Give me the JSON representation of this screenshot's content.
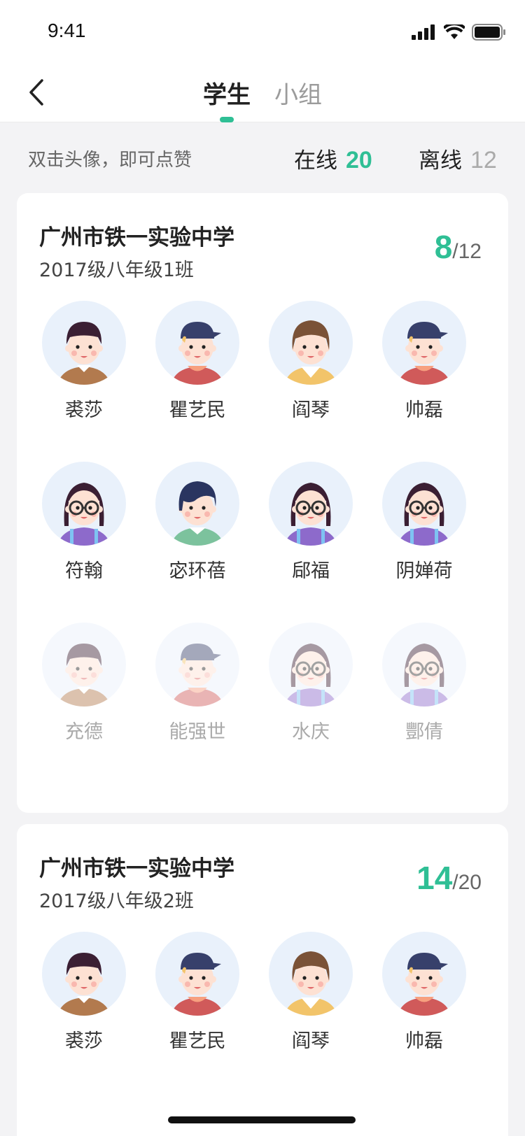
{
  "status": {
    "time": "9:41"
  },
  "header": {
    "tabs": [
      {
        "label": "学生",
        "active": true
      },
      {
        "label": "小组",
        "active": false
      }
    ]
  },
  "summary": {
    "hint": "双击头像，即可点赞",
    "online_label": "在线",
    "online_count": "20",
    "offline_label": "离线",
    "offline_count": "12"
  },
  "colors": {
    "accent": "#2fbf95"
  },
  "classes": [
    {
      "school": "广州市铁一实验中学",
      "class": "2017级八年级1班",
      "online": "8",
      "total": "/12",
      "students": [
        {
          "name": "裘莎",
          "avatar": "boy-bowl-hair",
          "online": true
        },
        {
          "name": "瞿艺民",
          "avatar": "boy-cap",
          "online": true
        },
        {
          "name": "阎琴",
          "avatar": "girl-brown-hair",
          "online": true
        },
        {
          "name": "帅磊",
          "avatar": "boy-cap",
          "online": true
        },
        {
          "name": "符翰",
          "avatar": "girl-glasses",
          "online": true
        },
        {
          "name": "宓环蓓",
          "avatar": "boy-side-hair",
          "online": true
        },
        {
          "name": "郈福",
          "avatar": "girl-glasses",
          "online": true
        },
        {
          "name": "阴婵荷",
          "avatar": "girl-glasses",
          "online": true
        },
        {
          "name": "充德",
          "avatar": "boy-bowl-hair",
          "online": false
        },
        {
          "name": "能强世",
          "avatar": "boy-cap",
          "online": false
        },
        {
          "name": "水庆",
          "avatar": "girl-glasses",
          "online": false
        },
        {
          "name": "酆倩",
          "avatar": "girl-glasses",
          "online": false
        }
      ]
    },
    {
      "school": "广州市铁一实验中学",
      "class": "2017级八年级2班",
      "online": "14",
      "total": "/20",
      "students": [
        {
          "name": "裘莎",
          "avatar": "boy-bowl-hair",
          "online": true
        },
        {
          "name": "瞿艺民",
          "avatar": "boy-cap",
          "online": true
        },
        {
          "name": "阎琴",
          "avatar": "girl-brown-hair",
          "online": true
        },
        {
          "name": "帅磊",
          "avatar": "boy-cap",
          "online": true
        }
      ]
    }
  ]
}
